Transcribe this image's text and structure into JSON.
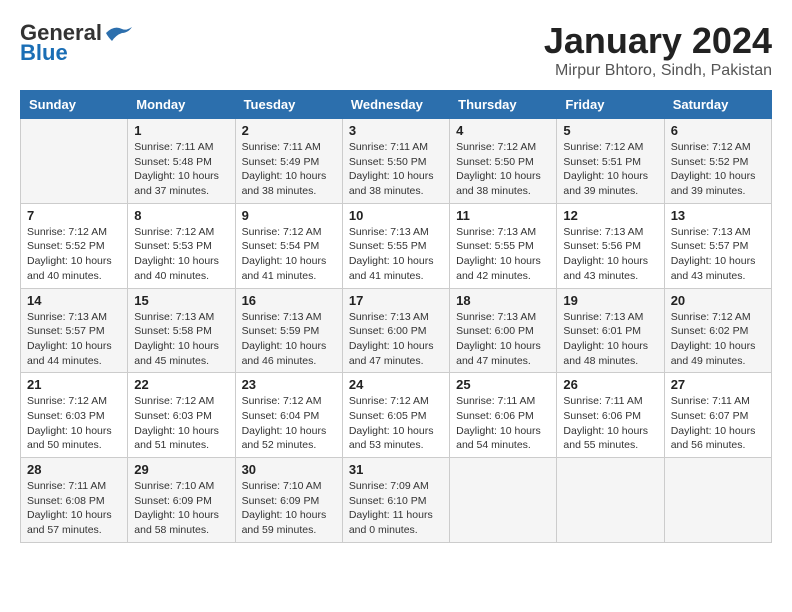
{
  "header": {
    "logo_general": "General",
    "logo_blue": "Blue",
    "title": "January 2024",
    "location": "Mirpur Bhtoro, Sindh, Pakistan"
  },
  "days_of_week": [
    "Sunday",
    "Monday",
    "Tuesday",
    "Wednesday",
    "Thursday",
    "Friday",
    "Saturday"
  ],
  "weeks": [
    [
      {
        "day": "",
        "info": ""
      },
      {
        "day": "1",
        "info": "Sunrise: 7:11 AM\nSunset: 5:48 PM\nDaylight: 10 hours\nand 37 minutes."
      },
      {
        "day": "2",
        "info": "Sunrise: 7:11 AM\nSunset: 5:49 PM\nDaylight: 10 hours\nand 38 minutes."
      },
      {
        "day": "3",
        "info": "Sunrise: 7:11 AM\nSunset: 5:50 PM\nDaylight: 10 hours\nand 38 minutes."
      },
      {
        "day": "4",
        "info": "Sunrise: 7:12 AM\nSunset: 5:50 PM\nDaylight: 10 hours\nand 38 minutes."
      },
      {
        "day": "5",
        "info": "Sunrise: 7:12 AM\nSunset: 5:51 PM\nDaylight: 10 hours\nand 39 minutes."
      },
      {
        "day": "6",
        "info": "Sunrise: 7:12 AM\nSunset: 5:52 PM\nDaylight: 10 hours\nand 39 minutes."
      }
    ],
    [
      {
        "day": "7",
        "info": "Sunrise: 7:12 AM\nSunset: 5:52 PM\nDaylight: 10 hours\nand 40 minutes."
      },
      {
        "day": "8",
        "info": "Sunrise: 7:12 AM\nSunset: 5:53 PM\nDaylight: 10 hours\nand 40 minutes."
      },
      {
        "day": "9",
        "info": "Sunrise: 7:12 AM\nSunset: 5:54 PM\nDaylight: 10 hours\nand 41 minutes."
      },
      {
        "day": "10",
        "info": "Sunrise: 7:13 AM\nSunset: 5:55 PM\nDaylight: 10 hours\nand 41 minutes."
      },
      {
        "day": "11",
        "info": "Sunrise: 7:13 AM\nSunset: 5:55 PM\nDaylight: 10 hours\nand 42 minutes."
      },
      {
        "day": "12",
        "info": "Sunrise: 7:13 AM\nSunset: 5:56 PM\nDaylight: 10 hours\nand 43 minutes."
      },
      {
        "day": "13",
        "info": "Sunrise: 7:13 AM\nSunset: 5:57 PM\nDaylight: 10 hours\nand 43 minutes."
      }
    ],
    [
      {
        "day": "14",
        "info": "Sunrise: 7:13 AM\nSunset: 5:57 PM\nDaylight: 10 hours\nand 44 minutes."
      },
      {
        "day": "15",
        "info": "Sunrise: 7:13 AM\nSunset: 5:58 PM\nDaylight: 10 hours\nand 45 minutes."
      },
      {
        "day": "16",
        "info": "Sunrise: 7:13 AM\nSunset: 5:59 PM\nDaylight: 10 hours\nand 46 minutes."
      },
      {
        "day": "17",
        "info": "Sunrise: 7:13 AM\nSunset: 6:00 PM\nDaylight: 10 hours\nand 47 minutes."
      },
      {
        "day": "18",
        "info": "Sunrise: 7:13 AM\nSunset: 6:00 PM\nDaylight: 10 hours\nand 47 minutes."
      },
      {
        "day": "19",
        "info": "Sunrise: 7:13 AM\nSunset: 6:01 PM\nDaylight: 10 hours\nand 48 minutes."
      },
      {
        "day": "20",
        "info": "Sunrise: 7:12 AM\nSunset: 6:02 PM\nDaylight: 10 hours\nand 49 minutes."
      }
    ],
    [
      {
        "day": "21",
        "info": "Sunrise: 7:12 AM\nSunset: 6:03 PM\nDaylight: 10 hours\nand 50 minutes."
      },
      {
        "day": "22",
        "info": "Sunrise: 7:12 AM\nSunset: 6:03 PM\nDaylight: 10 hours\nand 51 minutes."
      },
      {
        "day": "23",
        "info": "Sunrise: 7:12 AM\nSunset: 6:04 PM\nDaylight: 10 hours\nand 52 minutes."
      },
      {
        "day": "24",
        "info": "Sunrise: 7:12 AM\nSunset: 6:05 PM\nDaylight: 10 hours\nand 53 minutes."
      },
      {
        "day": "25",
        "info": "Sunrise: 7:11 AM\nSunset: 6:06 PM\nDaylight: 10 hours\nand 54 minutes."
      },
      {
        "day": "26",
        "info": "Sunrise: 7:11 AM\nSunset: 6:06 PM\nDaylight: 10 hours\nand 55 minutes."
      },
      {
        "day": "27",
        "info": "Sunrise: 7:11 AM\nSunset: 6:07 PM\nDaylight: 10 hours\nand 56 minutes."
      }
    ],
    [
      {
        "day": "28",
        "info": "Sunrise: 7:11 AM\nSunset: 6:08 PM\nDaylight: 10 hours\nand 57 minutes."
      },
      {
        "day": "29",
        "info": "Sunrise: 7:10 AM\nSunset: 6:09 PM\nDaylight: 10 hours\nand 58 minutes."
      },
      {
        "day": "30",
        "info": "Sunrise: 7:10 AM\nSunset: 6:09 PM\nDaylight: 10 hours\nand 59 minutes."
      },
      {
        "day": "31",
        "info": "Sunrise: 7:09 AM\nSunset: 6:10 PM\nDaylight: 11 hours\nand 0 minutes."
      },
      {
        "day": "",
        "info": ""
      },
      {
        "day": "",
        "info": ""
      },
      {
        "day": "",
        "info": ""
      }
    ]
  ]
}
